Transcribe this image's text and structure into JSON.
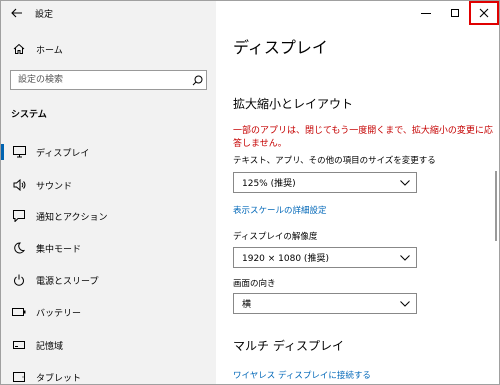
{
  "app": {
    "title": "設定"
  },
  "sidebar": {
    "home": "ホーム",
    "search_placeholder": "設定の検索",
    "section": "システム",
    "items": [
      {
        "label": "ディスプレイ",
        "icon": "monitor-icon"
      },
      {
        "label": "サウンド",
        "icon": "speaker-icon"
      },
      {
        "label": "通知とアクション",
        "icon": "notification-icon"
      },
      {
        "label": "集中モード",
        "icon": "moon-icon"
      },
      {
        "label": "電源とスリープ",
        "icon": "power-icon"
      },
      {
        "label": "バッテリー",
        "icon": "battery-icon"
      },
      {
        "label": "記憶域",
        "icon": "storage-icon"
      },
      {
        "label": "タブレット",
        "icon": "tablet-icon"
      }
    ],
    "active_index": 0
  },
  "main": {
    "title": "ディスプレイ",
    "scale_section": "拡大縮小とレイアウト",
    "warning": "一部のアプリは、閉じてもう一度開くまで、拡大縮小の変更に応答しません。",
    "scale_label": "テキスト、アプリ、その他の項目のサイズを変更する",
    "scale_value": "125% (推奨)",
    "advanced_scaling_link": "表示スケールの詳細設定",
    "resolution_label": "ディスプレイの解像度",
    "resolution_value": "1920 × 1080 (推奨)",
    "orientation_label": "画面の向き",
    "orientation_value": "横",
    "multi_section": "マルチ ディスプレイ",
    "wireless_link": "ワイヤレス ディスプレイに接続する"
  },
  "colors": {
    "accent": "#0067b8",
    "warning": "#c50000",
    "close_highlight": "#e00000"
  }
}
